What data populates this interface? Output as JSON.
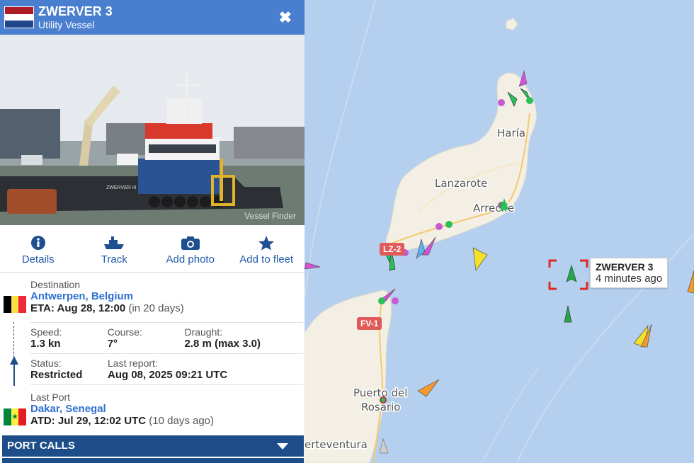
{
  "vessel": {
    "name": "ZWERVER 3",
    "type": "Utility Vessel",
    "close_label": "✖",
    "flag_colors": [
      "#ae1c28",
      "#ffffff",
      "#21468b"
    ]
  },
  "photo": {
    "credit": "Vessel Finder"
  },
  "actions": [
    {
      "label": "Details",
      "icon": "info-icon"
    },
    {
      "label": "Track",
      "icon": "ship-track-icon"
    },
    {
      "label": "Add photo",
      "icon": "camera-icon"
    },
    {
      "label": "Add to fleet",
      "icon": "star-icon"
    }
  ],
  "destination": {
    "label": "Destination",
    "name": "Antwerpen, Belgium",
    "eta_prefix": "ETA:",
    "eta": "Aug 28, 12:00",
    "eta_rel": "(in 20 days)",
    "flag_colors": [
      "#000000",
      "#fae042",
      "#ed2939"
    ]
  },
  "stats": {
    "speed_label": "Speed:",
    "speed": "1.3 kn",
    "course_label": "Course:",
    "course": "7°",
    "draught_label": "Draught:",
    "draught": "2.8 m (max 3.0)",
    "status_label": "Status:",
    "status": "Restricted",
    "report_label": "Last report:",
    "report": "Aug 08, 2025 09:21 UTC"
  },
  "last_port": {
    "label": "Last Port",
    "name": "Dakar, Senegal",
    "atd_prefix": "ATD:",
    "atd": "Jul 29, 12:02 UTC",
    "atd_rel": "(10 days ago)",
    "flag_colors": [
      "#00853f",
      "#fdef42",
      "#e31b23"
    ]
  },
  "sections": {
    "port_calls": "PORT CALLS"
  },
  "map": {
    "labels": [
      "Haría",
      "Lanzarote",
      "Arrecife",
      "Puerto del",
      "Rosario",
      "erteventura"
    ],
    "roads": [
      "LZ-2",
      "FV-1"
    ],
    "tooltip_name": "ZWERVER 3",
    "tooltip_time": "4 minutes ago"
  }
}
